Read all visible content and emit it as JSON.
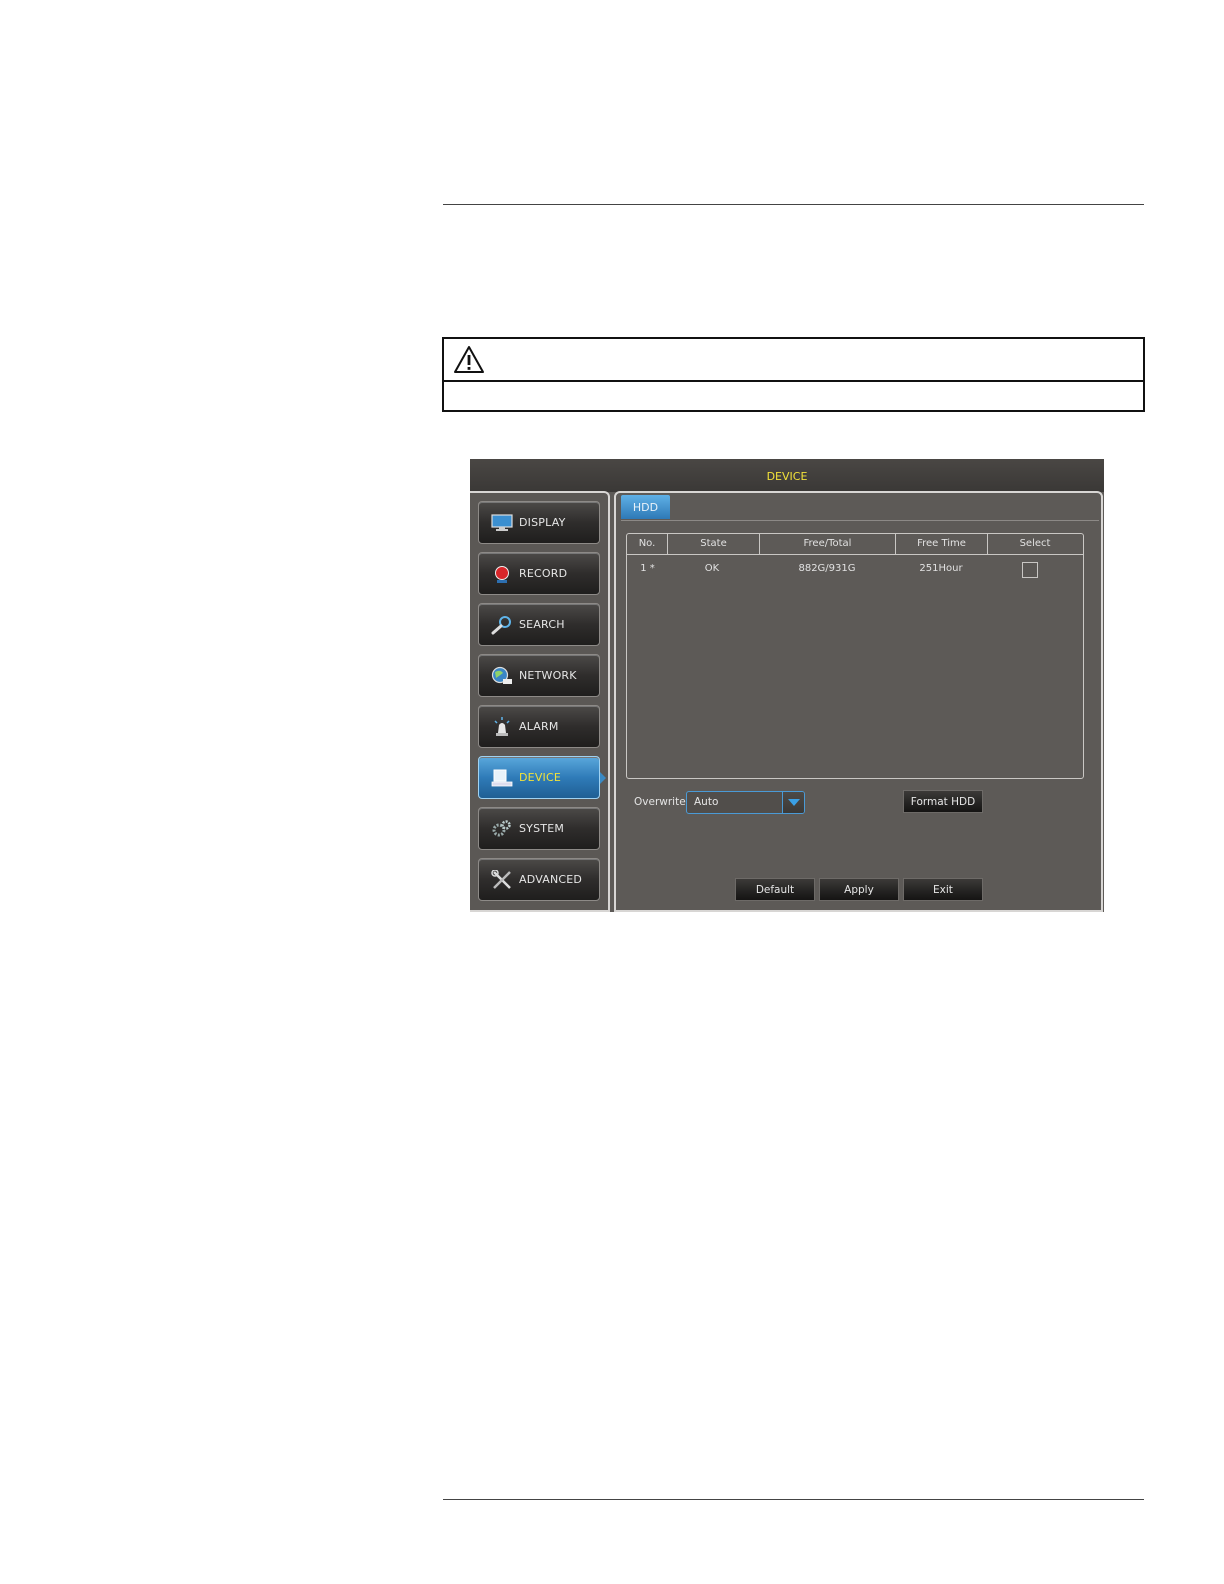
{
  "dvr": {
    "title": "DEVICE",
    "nav": [
      {
        "label": "DISPLAY",
        "icon": "monitor-icon"
      },
      {
        "label": "RECORD",
        "icon": "record-icon"
      },
      {
        "label": "SEARCH",
        "icon": "magnifier-icon"
      },
      {
        "label": "NETWORK",
        "icon": "globe-icon"
      },
      {
        "label": "ALARM",
        "icon": "alarm-icon"
      },
      {
        "label": "DEVICE",
        "icon": "laptop-icon",
        "active": true
      },
      {
        "label": "SYSTEM",
        "icon": "gears-icon"
      },
      {
        "label": "ADVANCED",
        "icon": "tools-icon"
      }
    ],
    "tab": "HDD",
    "table": {
      "headers": [
        "No.",
        "State",
        "Free/Total",
        "Free Time",
        "Select"
      ],
      "rows": [
        {
          "no": "1 *",
          "state": "OK",
          "free_total": "882G/931G",
          "free_time": "251Hour",
          "selected": false
        }
      ]
    },
    "overwrite": {
      "label": "Overwrite",
      "value": "Auto"
    },
    "buttons": {
      "format": "Format HDD",
      "default": "Default",
      "apply": "Apply",
      "exit": "Exit"
    },
    "colors": {
      "title_text": "#f2e23a",
      "active_tab": "#2e79b6",
      "panel_bg": "#5d5a57"
    }
  }
}
